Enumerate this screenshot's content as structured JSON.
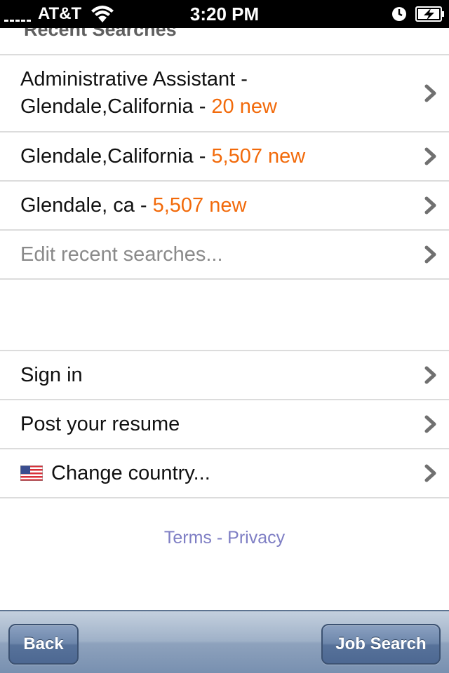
{
  "status_bar": {
    "carrier": "AT&T",
    "time": "3:20 PM"
  },
  "recent_searches": {
    "header": "Recent Searches",
    "items": [
      {
        "label": "Administrative Assistant - Glendale,California - ",
        "count": "20 new"
      },
      {
        "label": "Glendale,California - ",
        "count": "5,507 new"
      },
      {
        "label": "Glendale, ca - ",
        "count": "5,507 new"
      }
    ],
    "edit_label": "Edit recent searches..."
  },
  "account": {
    "sign_in": "Sign in",
    "post_resume": "Post your resume",
    "change_country": "Change country..."
  },
  "footer": {
    "terms": "Terms",
    "separator": " - ",
    "privacy": "Privacy"
  },
  "toolbar": {
    "back_label": "Back",
    "job_search_label": "Job Search"
  },
  "colors": {
    "count_accent": "#f26a0a",
    "link": "#7e7ec4",
    "toolbar": "#8ea2bd"
  }
}
